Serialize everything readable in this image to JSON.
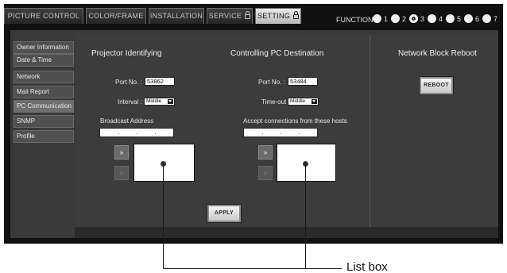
{
  "tabs": [
    {
      "label": "PICTURE CONTROL",
      "locked": false,
      "active": false
    },
    {
      "label": "COLOR/FRAME",
      "locked": false,
      "active": false
    },
    {
      "label": "INSTALLATION",
      "locked": false,
      "active": false
    },
    {
      "label": "SERVICE",
      "locked": true,
      "active": false
    },
    {
      "label": "SETTING",
      "locked": true,
      "active": true
    }
  ],
  "function_bar": {
    "label": "FUNCTION",
    "buttons": [
      "1",
      "2",
      "3",
      "4",
      "5",
      "6",
      "7"
    ],
    "selected": "3"
  },
  "sidebar": {
    "items": [
      {
        "label": "Owner Information"
      },
      {
        "label": "Date & Time"
      },
      {
        "label": "Network"
      },
      {
        "label": "Mail Report"
      },
      {
        "label": "PC Communication"
      },
      {
        "label": "SNMP"
      },
      {
        "label": "Profile"
      }
    ],
    "active_index": 4
  },
  "projector_identifying": {
    "title": "Projector Identifying",
    "port_label": "Port No. :",
    "port_value": "53862",
    "interval_label": "Interval :",
    "interval_value": "Middle",
    "broadcast_label": "Broadcast Address",
    "add_label": "»",
    "remove_label": "«"
  },
  "controlling_pc": {
    "title": "Controlling PC Destination",
    "port_label": "Port No. :",
    "port_value": "53484",
    "timeout_label": "Time-out",
    "timeout_value": "Middle",
    "hosts_label": "Accept connections from these hosts",
    "add_label": "»",
    "remove_label": "«"
  },
  "network_block_reboot": {
    "title": "Network Block Reboot",
    "reboot_label": "REBOOT"
  },
  "apply_label": "APPLY",
  "callout_label": "List box",
  "colors": {
    "background": "#101010",
    "panel": "#3c3c3c",
    "active_tab": "#d0d0d0",
    "button": "#e0e0e0"
  }
}
